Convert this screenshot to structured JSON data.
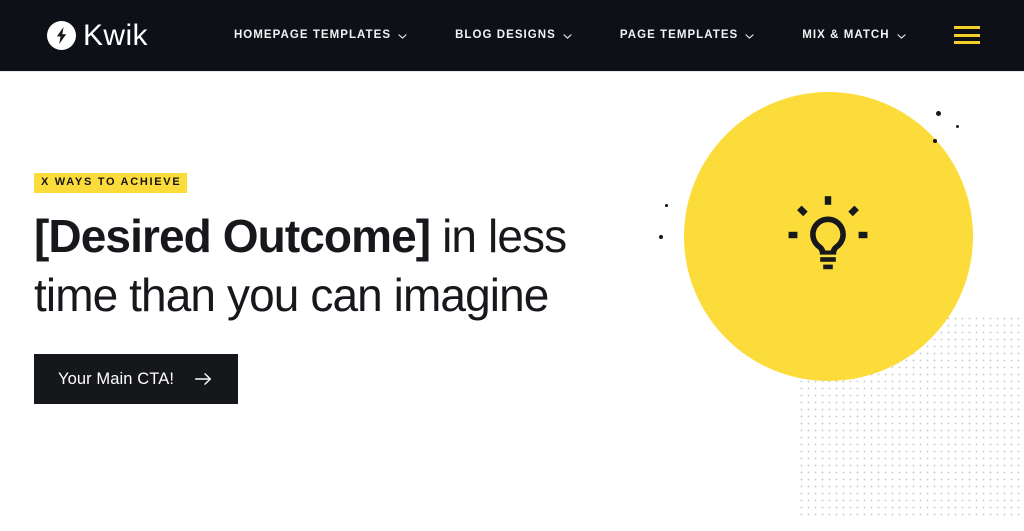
{
  "header": {
    "brand": {
      "name": "Kwik",
      "mark_icon": "lightning-bolt-icon"
    },
    "nav": [
      {
        "label": "HOMEPAGE TEMPLATES",
        "icon": "chevron-down-icon"
      },
      {
        "label": "BLOG DESIGNS",
        "icon": "chevron-down-icon"
      },
      {
        "label": "PAGE TEMPLATES",
        "icon": "chevron-down-icon"
      },
      {
        "label": "MIX & MATCH",
        "icon": "chevron-down-icon"
      }
    ],
    "menu_button_icon": "hamburger-menu-icon"
  },
  "hero": {
    "eyebrow": "X WAYS TO ACHIEVE",
    "headline_strong": "[Desired Outcome]",
    "headline_rest": " in less time than you can imagine",
    "cta": {
      "label": "Your Main CTA!",
      "icon": "arrow-right-icon"
    },
    "art": {
      "bulb_icon": "lightbulb-idea-icon",
      "pattern": "halftone-dot-grid"
    }
  },
  "colors": {
    "brand_yellow": "#FCDC3B",
    "soft_yellow": "#FAEA8F",
    "header_dark": "#0D1117",
    "text_dark": "#16181C",
    "menu_yellow": "#F2D024",
    "dot_grid": "#C9CBD0"
  }
}
